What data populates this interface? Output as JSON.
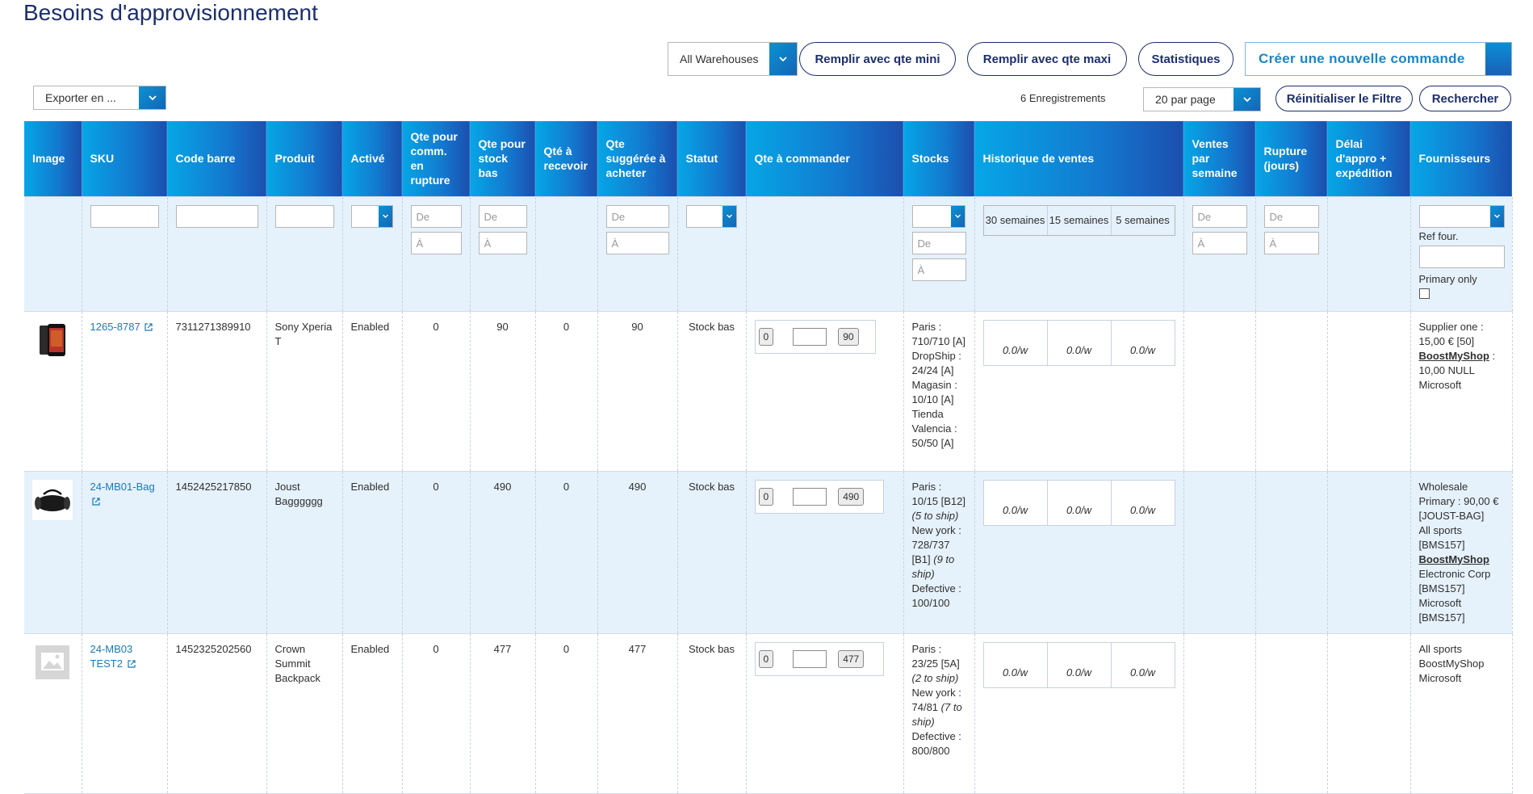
{
  "page": {
    "title": "Besoins d'approvisionnement"
  },
  "toolbar": {
    "warehouse_select": "All Warehouses",
    "fill_min_label": "Remplir avec qte mini",
    "fill_max_label": "Remplir avec qte maxi",
    "stats_label": "Statistiques",
    "create_order_label": "Créer une nouvelle commande",
    "export_select": "Exporter en ...",
    "records_count": "6 Enregistrements",
    "per_page_select": "20 par page",
    "reset_filter_label": "Réinitialiser le Filtre",
    "search_label": "Rechercher"
  },
  "columns": [
    "Image",
    "SKU",
    "Code barre",
    "Produit",
    "Activé",
    "Qte pour comm. en rupture",
    "Qte pour stock bas",
    "Qté à recevoir",
    "Qte suggérée à acheter",
    "Statut",
    "Qte à commander",
    "Stocks",
    "Historique de ventes",
    "Ventes par semaine",
    "Rupture (jours)",
    "Délai d'appro + expédition",
    "Fournisseurs"
  ],
  "filters": {
    "from_placeholder": "De",
    "to_placeholder": "À",
    "history_periods": [
      "30 semaines",
      "15 semaines",
      "5 semaines"
    ],
    "ref_four_label": "Ref four.",
    "primary_only_label": "Primary only"
  },
  "rows": [
    {
      "image": "phone",
      "sku": "1265-8787",
      "barcode": "7311271389910",
      "product": "Sony Xperia T",
      "enabled": "Enabled",
      "qty_out_of_stock": "0",
      "qty_low_stock": "90",
      "qty_to_receive": "0",
      "qty_suggested": "90",
      "status": "Stock bas",
      "order_min": "0",
      "order_suggested": "90",
      "stocks": [
        "Paris : 710/710 [A]",
        "DropShip : 24/24 [A]",
        "Magasin : 10/10 [A]",
        "Tienda Valencia : 50/50 [A]"
      ],
      "history": [
        "0.0/w",
        "0.0/w",
        "0.0/w"
      ],
      "suppliers": [
        {
          "text": "Supplier one : 15,00 € [50]",
          "bold": false
        },
        {
          "text": "BoostMyShop",
          "bold": true
        },
        {
          "text": " : 10,00 NULL",
          "bold": false
        },
        {
          "text": "Microsoft",
          "bold": false
        }
      ]
    },
    {
      "image": "bag",
      "sku": "24-MB01-Bag",
      "barcode": "1452425217850",
      "product": "Joust Bagggggg",
      "enabled": "Enabled",
      "qty_out_of_stock": "0",
      "qty_low_stock": "490",
      "qty_to_receive": "0",
      "qty_suggested": "490",
      "status": "Stock bas",
      "order_min": "0",
      "order_suggested": "490",
      "stocks_rich": [
        {
          "main": "Paris : 10/15 [B12]",
          "note": "(5 to ship)"
        },
        {
          "main": "New york : 728/737 [B1]",
          "note": "(9 to ship)"
        },
        {
          "main": "Defective : 100/100",
          "note": ""
        }
      ],
      "history": [
        "0.0/w",
        "0.0/w",
        "0.0/w"
      ],
      "suppliers": [
        {
          "text": "Wholesale Primary : 90,00 € [JOUST-BAG]",
          "bold": false
        },
        {
          "text": "All sports [BMS157]",
          "bold": false
        },
        {
          "text": "BoostMyShop",
          "bold": true
        },
        {
          "text": "Electronic Corp [BMS157]",
          "bold": false
        },
        {
          "text": "Microsoft [BMS157]",
          "bold": false
        }
      ]
    },
    {
      "image": "placeholder",
      "sku": "24-MB03 TEST2",
      "barcode": "1452325202560",
      "product": "Crown Summit Backpack",
      "enabled": "Enabled",
      "qty_out_of_stock": "0",
      "qty_low_stock": "477",
      "qty_to_receive": "0",
      "qty_suggested": "477",
      "status": "Stock bas",
      "order_min": "0",
      "order_suggested": "477",
      "stocks_rich": [
        {
          "main": "Paris : 23/25 [5A]",
          "note": "(2 to ship)"
        },
        {
          "main": "New york : 74/81",
          "note": "(7 to ship)"
        },
        {
          "main": "Defective : 800/800",
          "note": ""
        }
      ],
      "history": [
        "0.0/w",
        "0.0/w",
        "0.0/w"
      ],
      "suppliers": [
        {
          "text": "All sports",
          "bold": false
        },
        {
          "text": "BoostMyShop",
          "bold": false
        },
        {
          "text": "Microsoft",
          "bold": false
        }
      ]
    }
  ],
  "colors": {
    "title": "#1c2e6e",
    "header_start": "#06a6e6",
    "header_end": "#1c4fae",
    "alt_row": "#e5f1fb",
    "link": "#1a7ab8"
  }
}
